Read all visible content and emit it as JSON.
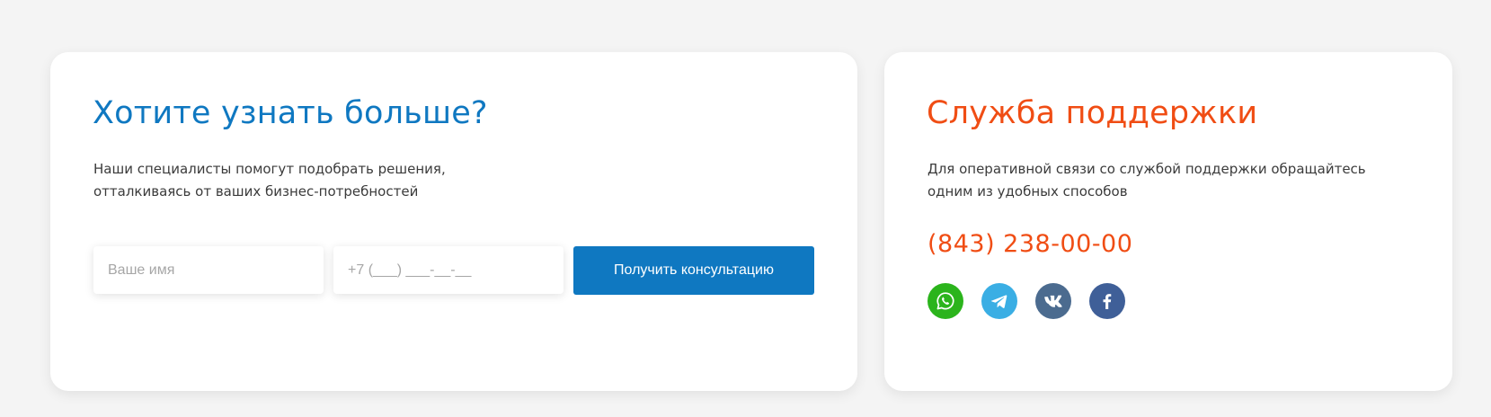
{
  "consult": {
    "title": "Хотите узнать больше?",
    "desc_line1": "Наши специалисты помогут подобрать решения,",
    "desc_line2": "отталкиваясь от ваших бизнес-потребностей",
    "name_placeholder": "Ваше имя",
    "phone_placeholder": "+7 (___) ___-__-__",
    "button_label": "Получить консультацию"
  },
  "support": {
    "title": "Служба поддержки",
    "desc_line1": "Для оперативной связи со службой поддержки обращайтесь",
    "desc_line2": "одним из удобных способов",
    "phone": "(843) 238-00-00",
    "socials": [
      {
        "name": "whatsapp-icon",
        "color": "#2bb41c"
      },
      {
        "name": "telegram-icon",
        "color": "#3aaee4"
      },
      {
        "name": "vk-icon",
        "color": "#4b6b8f"
      },
      {
        "name": "facebook-icon",
        "color": "#3f5f98"
      }
    ]
  },
  "colors": {
    "blue_accent": "#0f78c1",
    "orange_accent": "#f04d14",
    "background": "#f4f4f4",
    "card": "#ffffff"
  }
}
